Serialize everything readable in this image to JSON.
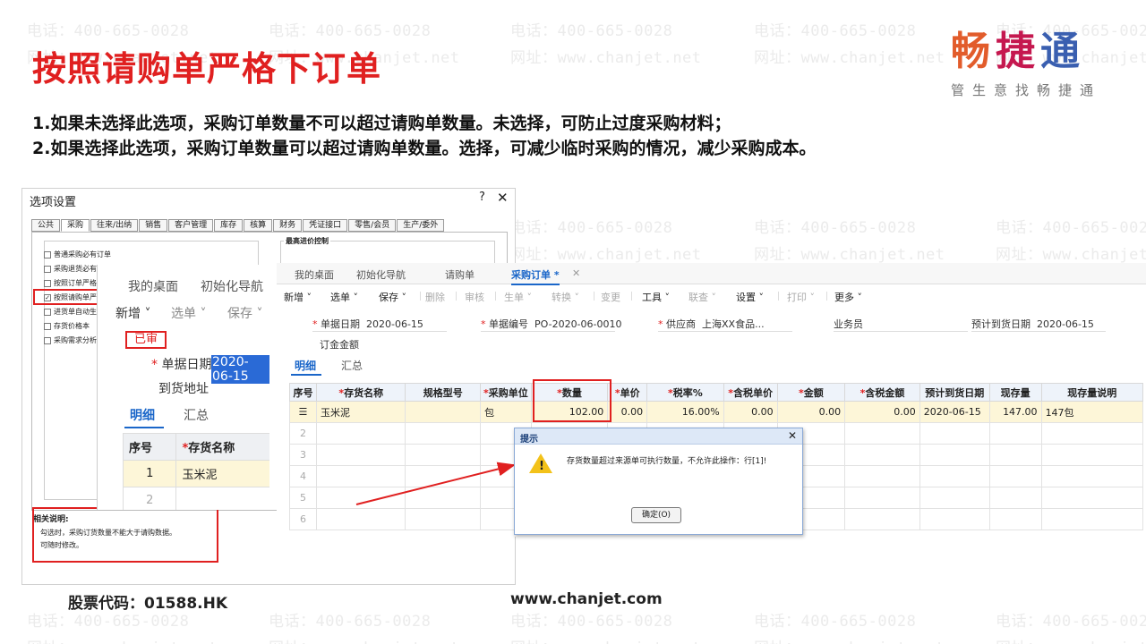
{
  "slide": {
    "title": "按照请购单严格下订单",
    "desc1": "1.如果未选择此选项，采购订单数量不可以超过请购单数量。未选择，可防止过度采购材料；",
    "desc2": "2.如果选择此选项，采购订单数量可以超过请购单数量。选择，可减少临时采购的情况，减少采购成本。",
    "footer_stock": "股票代码：01588.HK",
    "footer_site": "www.chanjet.com",
    "watermark_phone": "电话：400-665-0028",
    "watermark_site": "网址：www.chanjet.net"
  },
  "logo": {
    "char1": "畅",
    "char2": "捷",
    "char3": "通",
    "slogan": "管生意找畅捷通"
  },
  "options_dialog": {
    "title": "选项设置",
    "help_icon": "?",
    "close_icon": "✕",
    "tabs": [
      "公共",
      "采购",
      "往来/出纳",
      "销售",
      "客户管理",
      "库存",
      "核算",
      "财务",
      "凭证接口",
      "零售/会员",
      "生产/委外"
    ],
    "group_right_title": "最高进价控制",
    "options": [
      {
        "label": "普通采购必有订单",
        "checked": false
      },
      {
        "label": "采购退货必有",
        "checked": false
      },
      {
        "label": "按照订单严格",
        "checked": false
      },
      {
        "label": "按照请购单严格",
        "checked": true
      },
      {
        "label": "进货单自动生",
        "checked": false
      },
      {
        "label": "存货价格本",
        "checked": false
      },
      {
        "label": "采购需求分析",
        "checked": false
      }
    ],
    "related_title": "相关说明:",
    "related_line1": "勾选时，采购订货数量不能大于请购数据。",
    "related_line2": "可随时修改。"
  },
  "mid_panel": {
    "tab_desktop": "我的桌面",
    "tab_init": "初始化导航",
    "toolbar": [
      "新增",
      "选单",
      "保存"
    ],
    "status": "已审",
    "date_label": "单据日期",
    "date_value": "2020-06-15",
    "address_label": "到货地址",
    "tab_detail": "明细",
    "tab_summary": "汇总",
    "col_seq": "序号",
    "col_name": "存货名称",
    "row1_seq": "1",
    "row1_name": "玉米泥",
    "row2_seq": "2"
  },
  "main": {
    "tabs": [
      "我的桌面",
      "初始化导航",
      "请购单",
      "采购订单 *"
    ],
    "toolbar": [
      "新增",
      "选单",
      "保存",
      "删除",
      "审核",
      "生单",
      "转换",
      "变更",
      "工具",
      "联查",
      "设置",
      "打印",
      "更多"
    ],
    "fields": {
      "date_label": "单据日期",
      "date_value": "2020-06-15",
      "code_label": "单据编号",
      "code_value": "PO-2020-06-0010",
      "supplier_label": "供应商",
      "supplier_value": "上海XX食品...",
      "salesman_label": "业务员",
      "arrival_label": "预计到货日期",
      "arrival_value": "2020-06-15",
      "deposit_label": "订金金额"
    },
    "detail_tab": "明细",
    "summary_tab": "汇总",
    "columns": [
      "序号",
      "存货名称",
      "规格型号",
      "采购单位",
      "数量",
      "单价",
      "税率%",
      "含税单价",
      "金额",
      "含税金额",
      "预计到货日期",
      "现存量",
      "现存量说明"
    ],
    "row1": {
      "seq": "☰",
      "name": "玉米泥",
      "spec": "",
      "unit": "包",
      "qty": "102.00",
      "price": "0.00",
      "tax": "16.00%",
      "taxprice": "0.00",
      "amount": "0.00",
      "taxamount": "0.00",
      "date": "2020-06-15",
      "stock": "147.00",
      "stocknote": "147包"
    },
    "empty_rows": [
      "2",
      "3",
      "4",
      "5",
      "6"
    ]
  },
  "alert": {
    "title": "提示",
    "close": "✕",
    "message": "存货数量超过来源单可执行数量，不允许此操作：行[1]!",
    "ok": "确定(O)"
  },
  "colors": {
    "accent_red": "#e02020",
    "active_blue": "#1a66c9",
    "highlight_row": "#fdf6d8"
  }
}
